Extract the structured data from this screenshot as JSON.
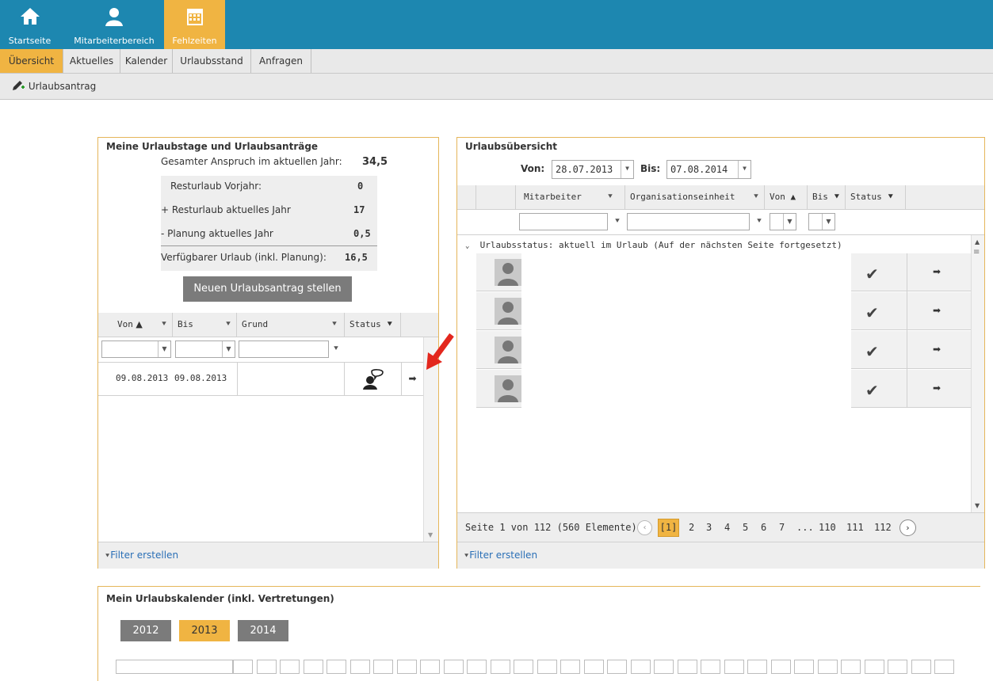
{
  "nav": {
    "items": [
      {
        "label": "Startseite",
        "icon": "home-icon"
      },
      {
        "label": "Mitarbeiterbereich",
        "icon": "user-icon"
      },
      {
        "label": "Fehlzeiten",
        "icon": "calendar-icon"
      }
    ]
  },
  "tabs": [
    "Übersicht",
    "Aktuelles",
    "Kalender",
    "Urlaubsstand",
    "Anfragen"
  ],
  "action": {
    "label": "Urlaubsantrag",
    "icon": "add-pen-icon"
  },
  "left_panel": {
    "title": "Meine Urlaubstage und Urlaubsanträge",
    "gesamt_label": "Gesamter Anspruch im aktuellen Jahr:",
    "gesamt_value": "34,5",
    "rows": [
      {
        "label": "Resturlaub Vorjahr:",
        "value": "0"
      },
      {
        "label": "+ Resturlaub aktuelles Jahr",
        "value": "17"
      },
      {
        "label": "- Planung aktuelles Jahr",
        "value": "0,5"
      },
      {
        "label": "Verfügbarer Urlaub (inkl. Planung):",
        "value": "16,5"
      }
    ],
    "new_button": "Neuen Urlaubsantrag stellen",
    "columns": [
      "Von",
      "Bis",
      "Grund",
      "Status"
    ],
    "entries": [
      {
        "von": "09.08.2013",
        "bis": "09.08.2013",
        "grund": ""
      }
    ],
    "filter_link": "Filter erstellen"
  },
  "right_panel": {
    "title": "Urlaubsübersicht",
    "von_label": "Von:",
    "von_value": "28.07.2013",
    "bis_label": "Bis:",
    "bis_value": "07.08.2014",
    "columns": [
      "Mitarbeiter",
      "Organisationseinheit",
      "Von",
      "Bis",
      "Status"
    ],
    "group_label": "Urlaubsstatus: aktuell im Urlaub (Auf der nächsten Seite fortgesetzt)",
    "pager_text": "Seite 1 von 112 (560 Elemente)",
    "pages": [
      "[1]",
      "2",
      "3",
      "4",
      "5",
      "6",
      "7",
      "...",
      "110",
      "111",
      "112"
    ],
    "filter_link": "Filter erstellen"
  },
  "calendar_panel": {
    "title": "Mein Urlaubskalender (inkl. Vertretungen)",
    "years": [
      "2012",
      "2013",
      "2014"
    ],
    "active_year": "2013"
  },
  "colors": {
    "nav_bg": "#1d87b0",
    "accent": "#f0b442",
    "arrow": "#e3271d"
  }
}
